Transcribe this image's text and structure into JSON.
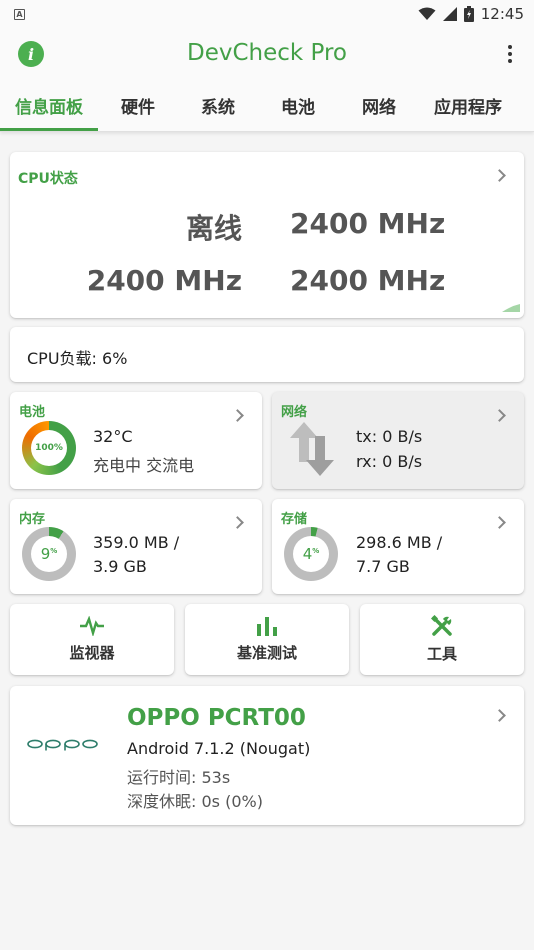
{
  "status_bar": {
    "time": "12:45",
    "left_icon": "a-notification-icon",
    "icons": [
      "wifi-icon",
      "signal-icon",
      "battery-icon"
    ]
  },
  "app_bar": {
    "title": "DevCheck Pro",
    "info_icon": "info-icon",
    "menu_icon": "more-vert-icon"
  },
  "tabs": [
    {
      "label": "信息面板",
      "active": true
    },
    {
      "label": "硬件",
      "active": false
    },
    {
      "label": "系统",
      "active": false
    },
    {
      "label": "电池",
      "active": false
    },
    {
      "label": "网络",
      "active": false
    },
    {
      "label": "应用程序",
      "active": false
    }
  ],
  "cpu_status": {
    "label": "CPU状态",
    "cores": [
      "离线",
      "2400 MHz",
      "2400 MHz",
      "2400 MHz"
    ]
  },
  "cpu_load": {
    "text": "CPU负载: 6%",
    "percent": 6
  },
  "battery": {
    "label": "电池",
    "ring_text": "100%",
    "percent": 100,
    "temp": "32°C",
    "status": "充电中 交流电"
  },
  "network": {
    "label": "网络",
    "tx": "tx: 0 B/s",
    "rx": "rx: 0 B/s"
  },
  "memory": {
    "label": "内存",
    "ring_value": "9",
    "ring_unit": "%",
    "percent": 9,
    "line1": "359.0 MB /",
    "line2": "3.9 GB"
  },
  "storage": {
    "label": "存储",
    "ring_value": "4",
    "ring_unit": "%",
    "percent": 4,
    "line1": "298.6 MB /",
    "line2": "7.7 GB"
  },
  "tools": [
    {
      "label": "监视器",
      "icon": "pulse-icon"
    },
    {
      "label": "基准测试",
      "icon": "bar-chart-icon"
    },
    {
      "label": "工具",
      "icon": "tools-icon"
    }
  ],
  "device": {
    "logo_text": "oppo",
    "title": "OPPO PCRT00",
    "android": "Android 7.1.2 (Nougat)",
    "uptime": "运行时间: 53s",
    "deep_sleep": "深度休眠: 0s (0%)"
  },
  "colors": {
    "accent": "#43a047",
    "ring_track": "#bdbdbd",
    "battery_gradient_start": "#f57c00",
    "battery_gradient_end": "#43a047"
  }
}
